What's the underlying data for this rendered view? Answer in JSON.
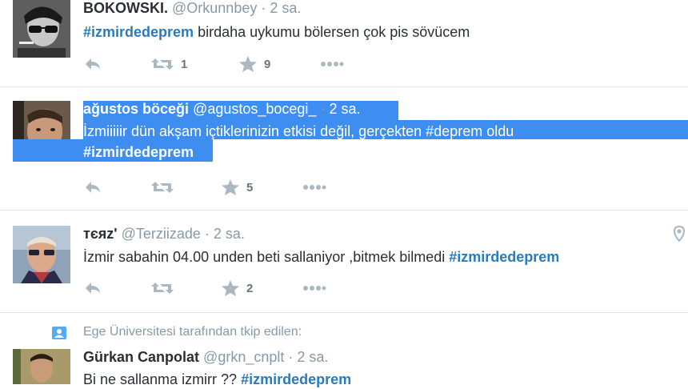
{
  "tweets": [
    {
      "name": "BOKOWSKI.",
      "handle": "@Orkunnbey",
      "time": "2 sa.",
      "text": "birdaha uykumu bölersen çok pis sövücem",
      "hashtag": "#izmirdedeprem",
      "retweets": "1",
      "favorites": "9"
    },
    {
      "name": "ağustos böceği",
      "handle": "@agustos_bocegi_",
      "time": "2 sa.",
      "line1": "İzmiiiiir dün akşam içtiklerinizin etkisi değil, gerçekten #deprem oldu",
      "hashtag": "#izmirdedeprem",
      "favorites": "5"
    },
    {
      "name": "тєяz'",
      "handle": "@Terziizade",
      "time": "2 sa.",
      "text": "İzmir sabahin 04.00 unden beti sallaniyor ,bitmek bilmedi",
      "hashtag": "#izmirdedeprem",
      "favorites": "2"
    },
    {
      "followed_by": "Ege Üniversitesi tarafından tkip edilen:",
      "name": "Gürkan Canpolat",
      "handle": "@grkn_cnplt",
      "time": "2 sa.",
      "text": "Bi ne sallanma izmirr ??",
      "hashtag": "#izmirdedeprem"
    }
  ],
  "dot": "·",
  "colors": {
    "hashtag": "#2b7bb9",
    "selection": "#3d8ef0",
    "muted": "#8899a6",
    "icon": "#aab8c2"
  },
  "icons": [
    "reply-icon",
    "retweet-icon",
    "favorite-icon",
    "more-icon",
    "location-icon",
    "follow-badge-icon"
  ]
}
